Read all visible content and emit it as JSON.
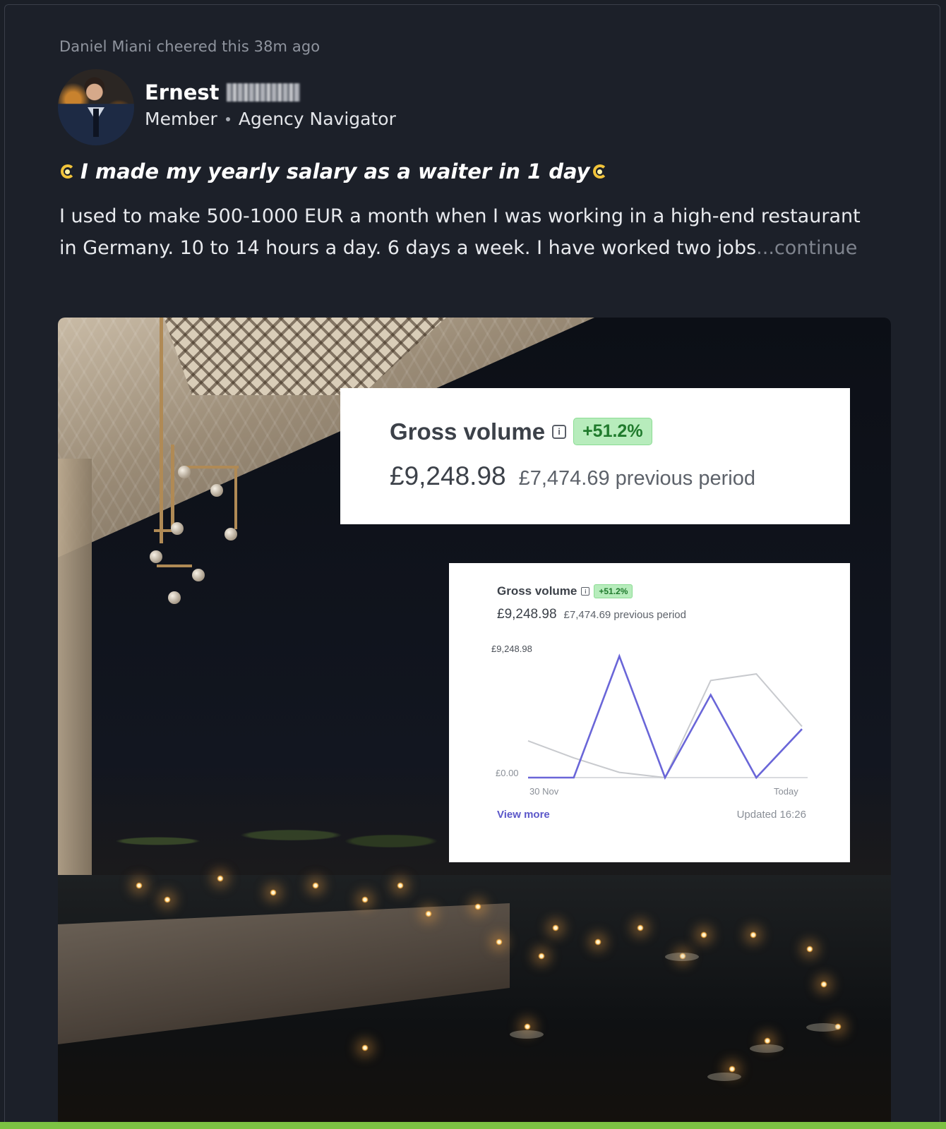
{
  "activity": {
    "text": "Daniel Miani cheered this 38m ago"
  },
  "author": {
    "first_name": "Ernest",
    "role": "Member",
    "group": "Agency Navigator"
  },
  "post": {
    "title": "I made my yearly salary as a waiter in 1 day",
    "body": "I used to make 500-1000 EUR a month when I was working in a high-end restaurant in Germany. 10 to 14 hours a day. 6 days a week. I have worked two jobs",
    "continue_label": "...continue"
  },
  "overlay_large": {
    "title": "Gross volume",
    "change_badge": "+51.2%",
    "amount": "£9,248.98",
    "previous": "£7,474.69 previous period"
  },
  "overlay_chart": {
    "title": "Gross volume",
    "change_badge": "+51.2%",
    "amount": "£9,248.98",
    "previous": "£7,474.69 previous period",
    "view_more": "View more",
    "updated": "Updated 16:26",
    "colors": {
      "current": "#6a66d8",
      "previous": "#c8cace",
      "axis": "#d9dbdf"
    }
  },
  "chart_data": {
    "type": "line",
    "x_labels": [
      "30 Nov",
      "Today"
    ],
    "y_tick_labels": [
      "£9,248.98",
      "£0.00"
    ],
    "ylim": [
      0,
      9248.98
    ],
    "series": [
      {
        "values": [
          0,
          0,
          9248.98,
          0,
          6300,
          0,
          3700
        ]
      },
      {
        "values": [
          2800,
          1500,
          400,
          0,
          7400,
          7900,
          3900
        ]
      }
    ],
    "grid": false
  }
}
